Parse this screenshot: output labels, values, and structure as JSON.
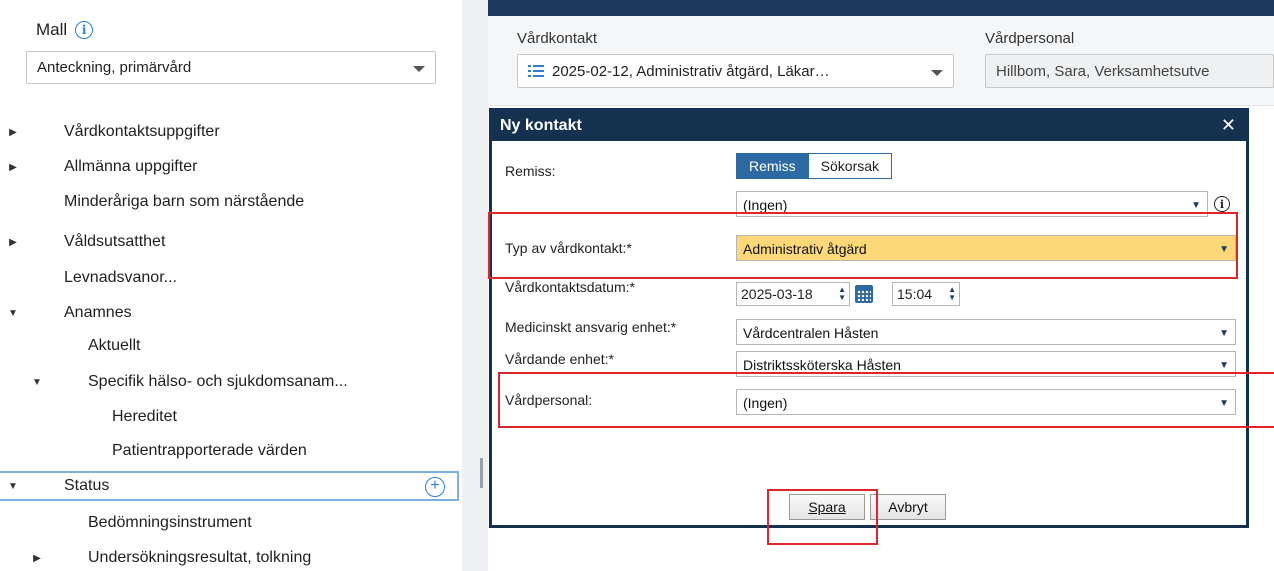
{
  "template": {
    "title": "Mall",
    "info_icon_glyph": "i",
    "selected": "Anteckning, primärvård"
  },
  "tree": [
    {
      "label": "Vårdkontaktsuppgifter",
      "expand": "collapsed"
    },
    {
      "label": "Allmänna uppgifter",
      "expand": "collapsed"
    },
    {
      "label": "Minderåriga barn som närstående",
      "expand": "none"
    },
    {
      "label": "Våldsutsatthet",
      "expand": "collapsed"
    },
    {
      "label": "Levnadsvanor...",
      "expand": "none"
    },
    {
      "label": "Anamnes",
      "expand": "expanded"
    },
    {
      "label": "Aktuellt",
      "expand": "none"
    },
    {
      "label": "Specifik hälso- och sjukdomsanam...",
      "expand": "expanded"
    },
    {
      "label": "Hereditet",
      "expand": "none"
    },
    {
      "label": "Patientrapporterade värden",
      "expand": "none"
    },
    {
      "label": "Status",
      "expand": "expanded",
      "selected": true
    },
    {
      "label": "Bedömningsinstrument",
      "expand": "none"
    },
    {
      "label": "Undersökningsresultat, tolkning",
      "expand": "collapsed"
    }
  ],
  "header": {
    "vardkontakt_label": "Vårdkontakt",
    "vardkontakt_value": "2025-02-12, Administrativ åtgärd, Läkar…",
    "vardpersonal_label": "Vårdpersonal",
    "vardpersonal_value": "Hillbom, Sara, Verksamhetsutve"
  },
  "dialog": {
    "title": "Ny kontakt",
    "close_glyph": "✕",
    "remiss_label": "Remiss:",
    "seg_remiss": "Remiss",
    "seg_sokorsak": "Sökorsak",
    "remiss_value": "(Ingen)",
    "typ_label": "Typ av vårdkontakt:*",
    "typ_value": "Administrativ åtgärd",
    "datum_label": "Vårdkontaktsdatum:*",
    "datum_value": "2025-03-18",
    "time_value": "15:04",
    "med_label": "Medicinskt ansvarig enhet:*",
    "med_value": "Vårdcentralen Håsten",
    "vardande_label": "Vårdande enhet:*",
    "vardande_value": "Distriktssköterska Håsten",
    "personal_label": "Vårdpersonal:",
    "personal_value": "(Ingen)",
    "save_label": "Spara",
    "cancel_label": "Avbryt"
  },
  "colors": {
    "dialog_title_bg": "#14314f",
    "highlight_field": "#fcd879",
    "annotation_red": "#e0262b",
    "accent_blue": "#2d6aa3"
  }
}
